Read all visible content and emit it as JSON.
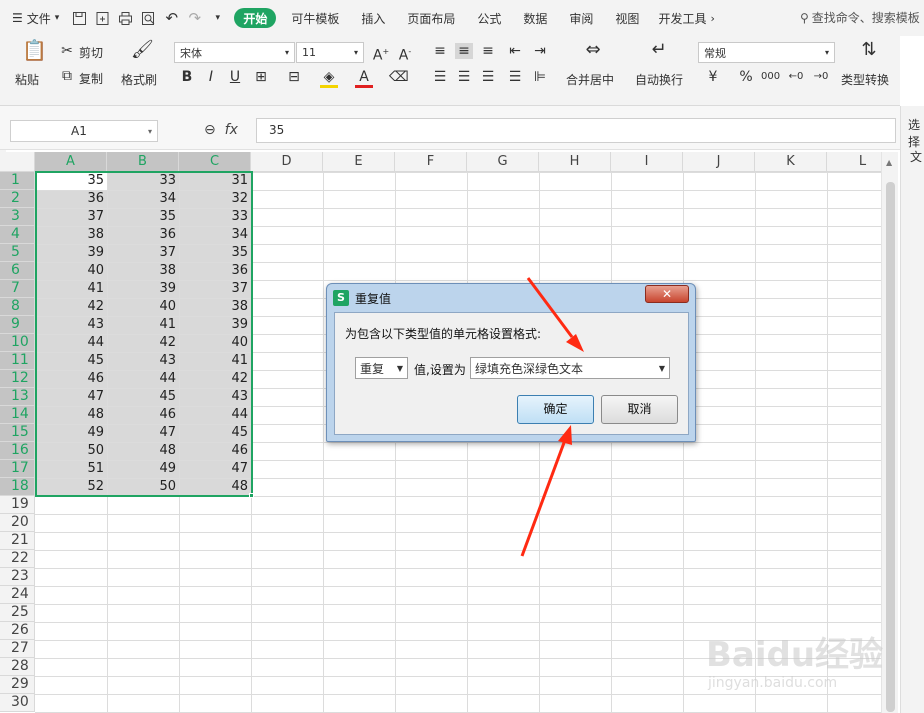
{
  "menubar": {
    "file": "文件",
    "tabs": [
      "开始",
      "可牛模板",
      "插入",
      "页面布局",
      "公式",
      "数据",
      "审阅",
      "视图",
      "开发工具"
    ],
    "search": "查找命令、搜索模板"
  },
  "ribbon": {
    "paste": "粘贴",
    "cut": "剪切",
    "copy": "复制",
    "format_painter": "格式刷",
    "font": "宋体",
    "size": "11",
    "merge": "合并居中",
    "wrap": "自动换行",
    "number_format": "常规",
    "convert": "类型转换"
  },
  "formula": {
    "namebox": "A1",
    "fx": "fx",
    "value": "35"
  },
  "right_panel": {
    "t1": "选择",
    "t2": "文"
  },
  "columns": [
    "A",
    "B",
    "C",
    "D",
    "E",
    "F",
    "G",
    "H",
    "I",
    "J",
    "K",
    "L"
  ],
  "rows": [
    "1",
    "2",
    "3",
    "4",
    "5",
    "6",
    "7",
    "8",
    "9",
    "10",
    "11",
    "12",
    "13",
    "14",
    "15",
    "16",
    "17",
    "18",
    "19",
    "20",
    "21",
    "22",
    "23",
    "24",
    "25",
    "26",
    "27",
    "28",
    "29",
    "30"
  ],
  "cells": {
    "A": [
      "35",
      "36",
      "37",
      "38",
      "39",
      "40",
      "41",
      "42",
      "43",
      "44",
      "45",
      "46",
      "47",
      "48",
      "49",
      "50",
      "51",
      "52"
    ],
    "B": [
      "33",
      "34",
      "35",
      "36",
      "37",
      "38",
      "39",
      "40",
      "41",
      "42",
      "43",
      "44",
      "45",
      "46",
      "47",
      "48",
      "49",
      "50"
    ],
    "C": [
      "31",
      "32",
      "33",
      "34",
      "35",
      "36",
      "37",
      "38",
      "39",
      "40",
      "41",
      "42",
      "43",
      "44",
      "45",
      "46",
      "47",
      "48"
    ]
  },
  "dialog": {
    "title": "重复值",
    "prompt": "为包含以下类型值的单元格设置格式:",
    "type_value": "重复",
    "mid_label": "值,设置为",
    "format_value": "绿填充色深绿色文本",
    "ok": "确定",
    "cancel": "取消"
  },
  "colors": {
    "accent": "#1fa462",
    "arrow": "#ff2a12"
  },
  "watermark": {
    "main": "Baidu经验",
    "sub": "jingyan.baidu.com"
  }
}
